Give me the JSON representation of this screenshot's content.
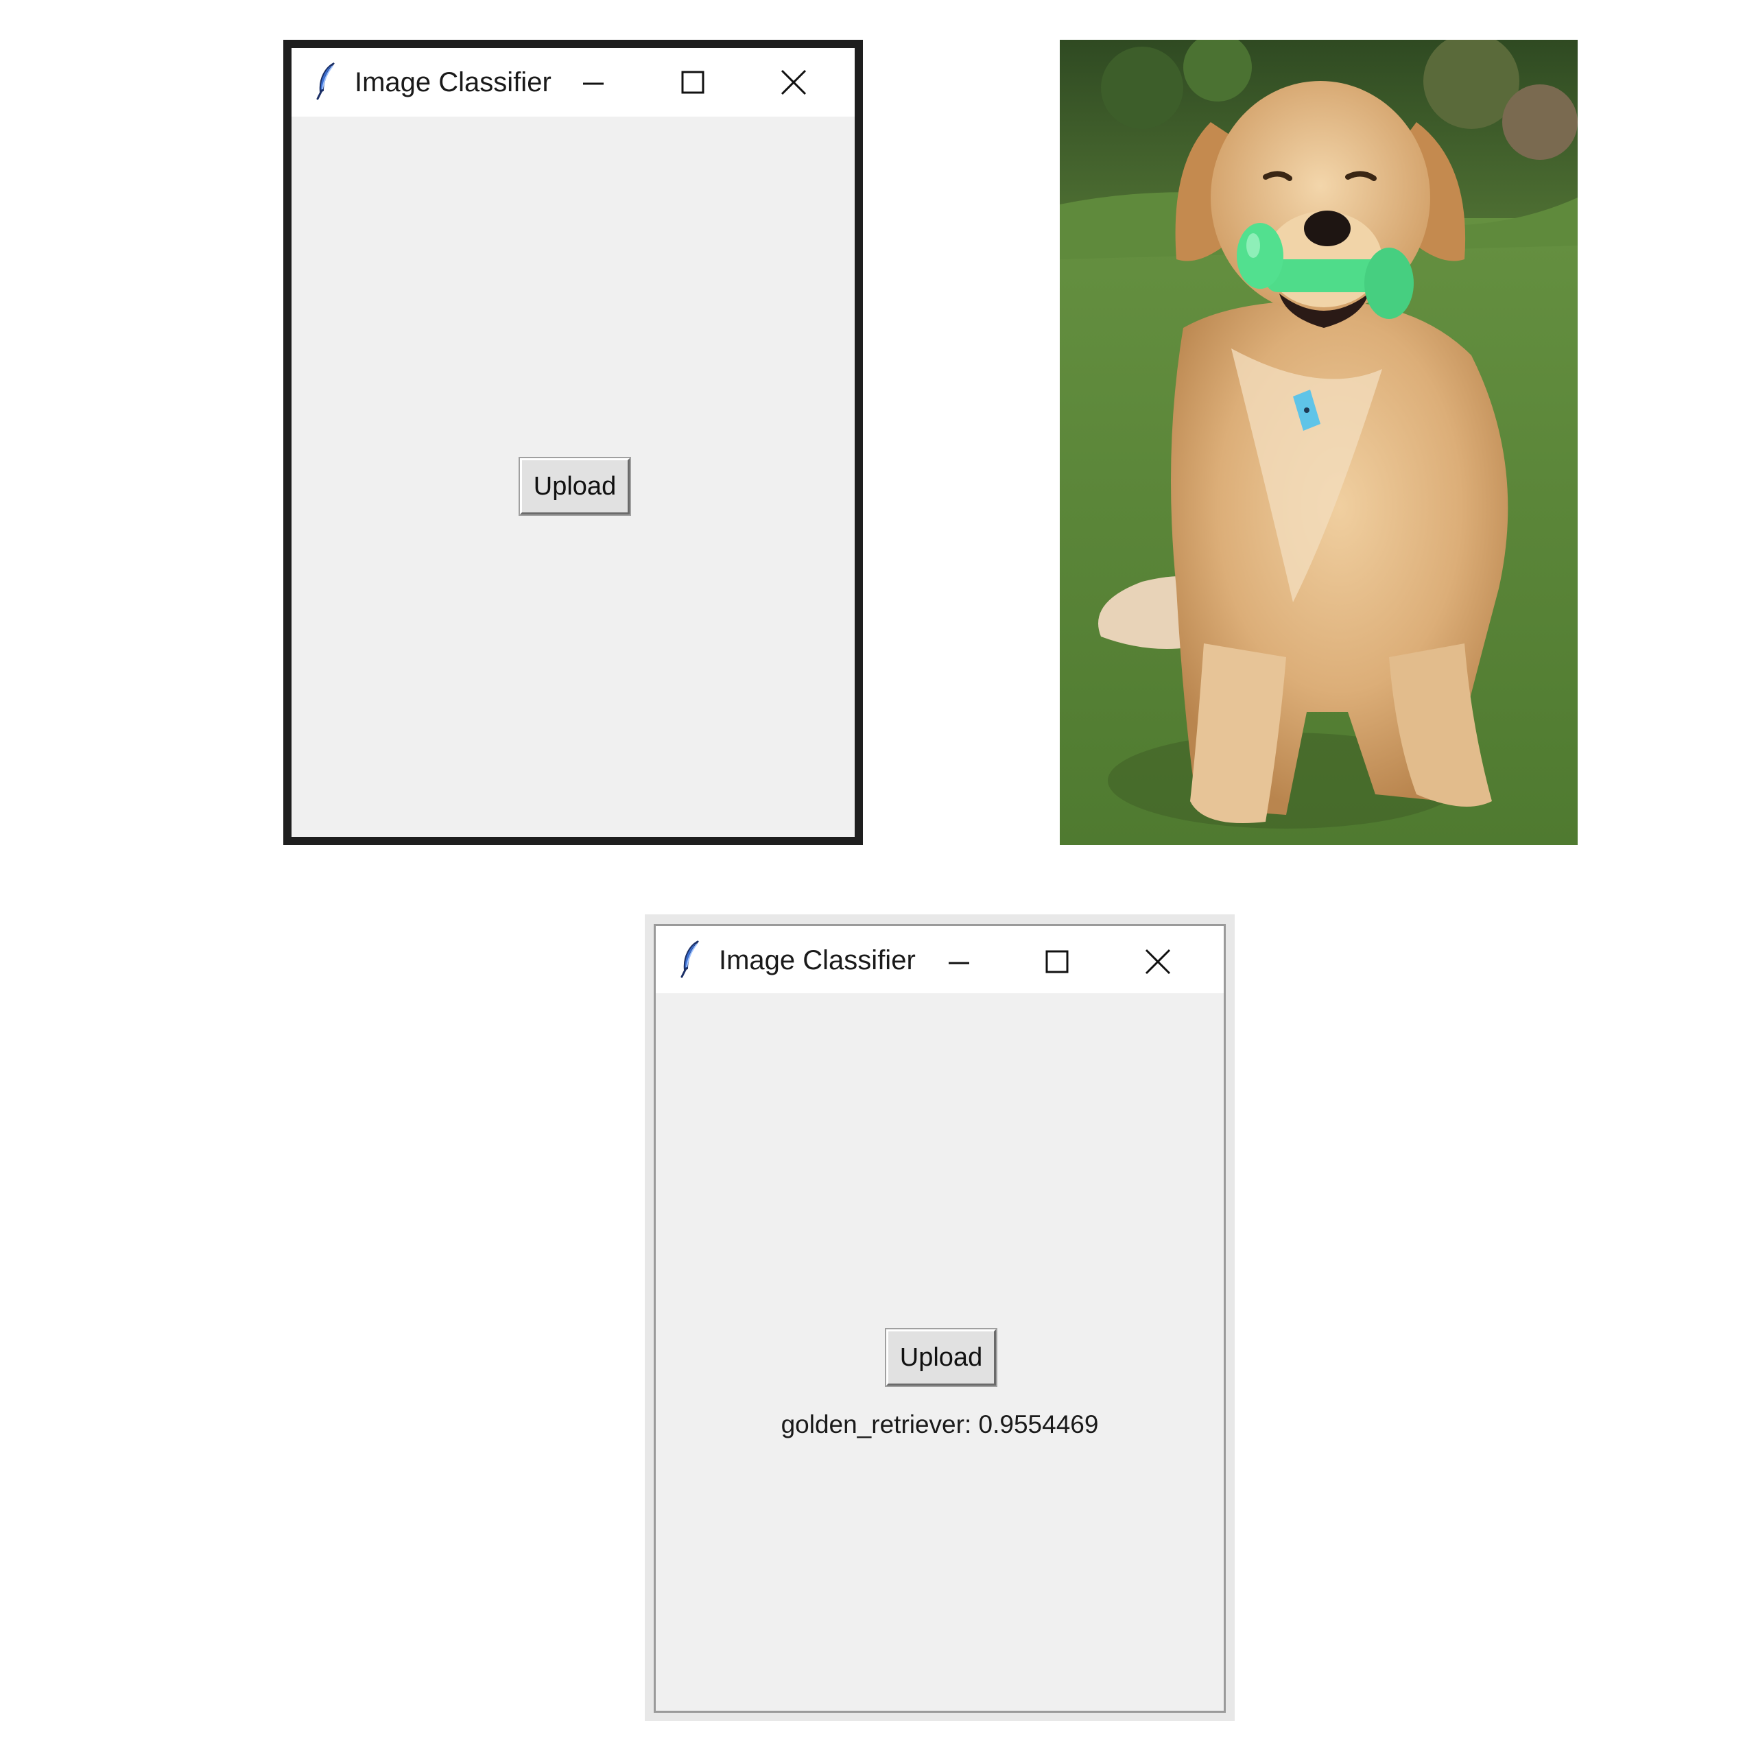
{
  "window_before": {
    "title": "Image Classifier",
    "upload_label": "Upload"
  },
  "window_after": {
    "title": "Image Classifier",
    "upload_label": "Upload",
    "result": "golden_retriever: 0.9554469"
  },
  "colors": {
    "window_bg": "#f0f0f0",
    "titlebar_bg": "#ffffff",
    "button_bg": "#e1e1e1",
    "toy_green": "#4fdc8a",
    "dog_fur": "#d9ae7a",
    "grass": "#5d8a3a"
  },
  "icons": {
    "app": "tk-feather-icon",
    "minimize": "minimize-icon",
    "maximize": "maximize-icon",
    "close": "close-icon"
  }
}
